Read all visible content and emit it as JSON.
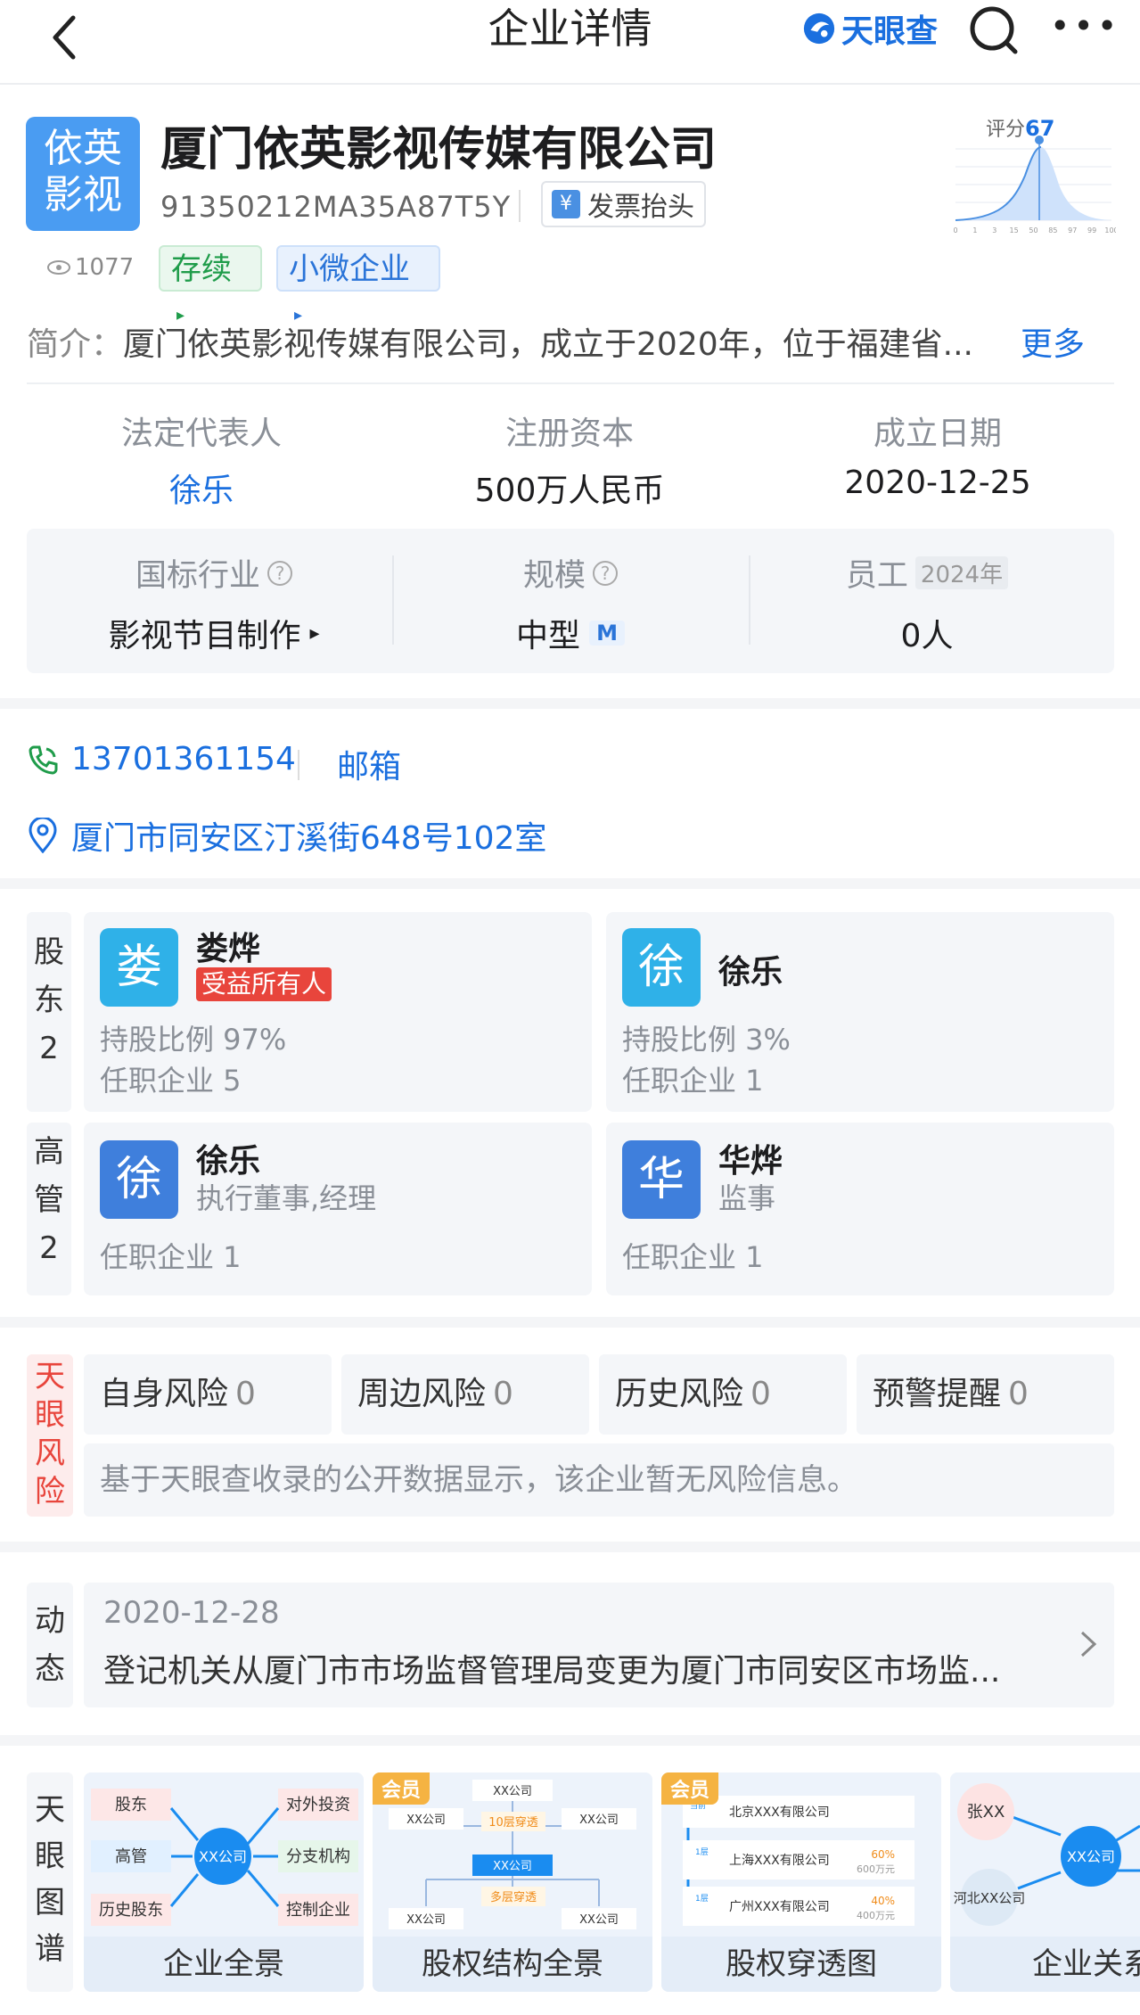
{
  "header": {
    "title": "企业详情",
    "brand": "天眼查"
  },
  "company": {
    "logo_line1": "依英",
    "logo_line2": "影视",
    "name": "厦门依英影视传媒有限公司",
    "credit_code": "91350212MA35A87T5Y",
    "invoice_label": "发票抬头",
    "invoice_icon_char": "¥",
    "views": "1077",
    "tags": [
      {
        "label": "存续",
        "arrow": "▸"
      },
      {
        "label": "小微企业",
        "arrow": "▸"
      }
    ],
    "score_label": "评分",
    "score_value": "67",
    "score_axis": [
      "0",
      "1",
      "3",
      "15",
      "50",
      "85",
      "97",
      "99",
      "100"
    ],
    "intro_label": "简介：",
    "intro_text": "厦门依英影视传媒有限公司，成立于2020年，位于福建省...",
    "intro_more": "更多",
    "legal_rep_label": "法定代表人",
    "legal_rep": "徐乐",
    "reg_capital_label": "注册资本",
    "reg_capital": "500万人民币",
    "founded_label": "成立日期",
    "founded": "2020-12-25",
    "industry_label": "国标行业",
    "industry": "影视节目制作",
    "industry_arrow": "▸",
    "scale_label": "规模",
    "scale": "中型",
    "scale_badge": "M",
    "employees_label": "员工",
    "employees_year": "2024年",
    "employees": "0人",
    "help_icon": "?"
  },
  "contact": {
    "phone": "13701361154",
    "email_label": "邮箱",
    "address": "厦门市同安区汀溪街648号102室"
  },
  "shareholders": {
    "label": [
      "股",
      "东",
      "2"
    ],
    "items": [
      {
        "avatar": "娄",
        "name": "娄烨",
        "badge": "受益所有人",
        "ratio": "持股比例 97%",
        "jobs": "任职企业 5"
      },
      {
        "avatar": "徐",
        "name": "徐乐",
        "ratio": "持股比例 3%",
        "jobs": "任职企业 1"
      }
    ]
  },
  "executives": {
    "label": [
      "高",
      "管",
      "2"
    ],
    "items": [
      {
        "avatar": "徐",
        "name": "徐乐",
        "role": "执行董事,经理",
        "jobs": "任职企业 1"
      },
      {
        "avatar": "华",
        "name": "华烨",
        "role": "监事",
        "jobs": "任职企业 1"
      }
    ]
  },
  "risk": {
    "label": [
      "天",
      "眼",
      "风",
      "险"
    ],
    "items": [
      {
        "label": "自身风险",
        "count": "0"
      },
      {
        "label": "周边风险",
        "count": "0"
      },
      {
        "label": "历史风险",
        "count": "0"
      },
      {
        "label": "预警提醒",
        "count": "0"
      }
    ],
    "note": "基于天眼查收录的公开数据显示，该企业暂无风险信息。"
  },
  "dynamics": {
    "label": [
      "动",
      "态"
    ],
    "date": "2020-12-28",
    "text": "登记机关从厦门市市场监督管理局变更为厦门市同安区市场监..."
  },
  "graph": {
    "label": [
      "天",
      "眼",
      "图",
      "谱"
    ],
    "cards": [
      {
        "caption": "企业全景",
        "nodes": [
          "股东",
          "高管",
          "历史股东",
          "XX公司",
          "对外投资",
          "分支机构",
          "控制企业"
        ]
      },
      {
        "caption": "股权结构全景",
        "vip": "会员",
        "nodes": [
          "XX公司",
          "XX公司",
          "10层穿透",
          "XX公司",
          "XX公司",
          "XX公司",
          "多层穿透",
          "XX公司"
        ]
      },
      {
        "caption": "股权穿透图",
        "vip": "会员",
        "rows": [
          {
            "tag": "当前",
            "name": "北京XXX有限公司"
          },
          {
            "tag": "1层",
            "name": "上海XXX有限公司",
            "pct": "60%",
            "amt": "600万元"
          },
          {
            "tag": "1层",
            "name": "广州XXX有限公司",
            "pct": "40%",
            "amt": "400万元"
          }
        ]
      },
      {
        "caption": "企业关系",
        "nodes": [
          "张XX",
          "XX公司",
          "河北XX公司"
        ]
      }
    ]
  },
  "colors": {
    "accent": "#1a6fdf",
    "green": "#1f9c4a",
    "red": "#e8453c",
    "vip": "#f5b342"
  }
}
